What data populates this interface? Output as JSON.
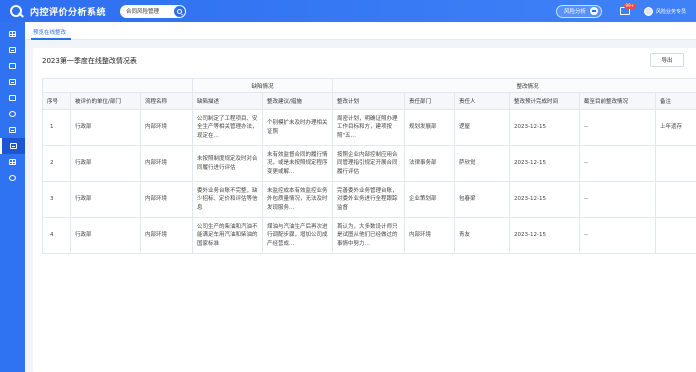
{
  "header": {
    "app_title": "内控评价分析系统",
    "search_value": "合同风险管理",
    "risk_button": "风险分析",
    "msg_badge": "99+",
    "user_name": "风险业务专员"
  },
  "sidebar": {
    "items": [
      {
        "icon": "grid-icon"
      },
      {
        "icon": "doc-icon"
      },
      {
        "icon": "monitor-icon"
      },
      {
        "icon": "calendar-icon"
      },
      {
        "icon": "folder-icon"
      },
      {
        "icon": "shield-icon"
      },
      {
        "icon": "chart-icon"
      },
      {
        "icon": "list-icon"
      },
      {
        "icon": "table-icon"
      },
      {
        "icon": "settings-icon"
      }
    ],
    "active_index": 7
  },
  "tabs": [
    {
      "label": "预览在线整改"
    }
  ],
  "card": {
    "title": "2023第一季度在线整改情况表",
    "export_label": "导出"
  },
  "table": {
    "groups": [
      "缺陷情况",
      "整改情况"
    ],
    "columns": [
      "序号",
      "被评价的单位/部门",
      "流程名称",
      "缺陷描述",
      "整改建议/措施",
      "整改计划",
      "责任部门",
      "责任人",
      "整改预计完成时间",
      "截至目前整改情况",
      "备注"
    ],
    "rows": [
      [
        "1",
        "行政部",
        "内部环境",
        "公司制定了工程项目、安全生产等相关管理办法，现定在…",
        "个别模扩未及时办理相关证照",
        "周密计划，明确证照办理工作目标和方，建项按照\"五…",
        "规划发展部",
        "逻屋",
        "2023-12-15",
        "--",
        "上年遗存"
      ],
      [
        "2",
        "行政部",
        "内部环境",
        "未按照制度规定及时对合同履行进行评估",
        "未有效监督合同的履行情况，或是未按照规定程序变更或解…",
        "按照企业内部控制应用合同管理指引规定开展合同履行评估",
        "法律事务部",
        "萨欣觉",
        "2023-12-15",
        "--",
        ""
      ],
      [
        "3",
        "行政部",
        "内部环境",
        "委外业务台账不完整，缺少招标、定价和评估等信息",
        "未监控成本有效监控业务外包质量情况，无法及时发现服务…",
        "完善委外业务管理台账，对委外业务进行全程跟踪监督",
        "企业策划部",
        "包春梁",
        "2023-12-15",
        "--",
        ""
      ],
      [
        "4",
        "行政部",
        "内部环境",
        "公司生产的柴油和汽油不能满足车用汽油和柴油的国家标准",
        "煤油与汽油生产后再次进行调配步骤，增加公司成产经营成…",
        "首认为，大多数设计师只是试图从他们已经做过的事情中努力…",
        "内部环境",
        "青友",
        "2023-12-15",
        "--",
        ""
      ]
    ]
  }
}
